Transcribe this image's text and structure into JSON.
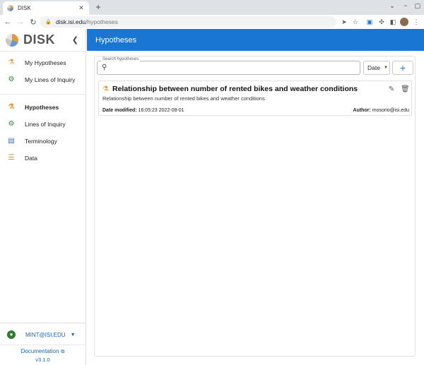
{
  "browser": {
    "tab_title": "DISK",
    "url_host": "disk.isi.edu",
    "url_path": "/hypotheses"
  },
  "sidebar": {
    "brand": "DISK",
    "nav_primary": [
      {
        "label": "My Hypotheses",
        "icon": "flask-icon"
      },
      {
        "label": "My Lines of Inquiry",
        "icon": "gear-icon"
      }
    ],
    "nav_secondary": [
      {
        "label": "Hypotheses",
        "icon": "flask-icon",
        "active": true
      },
      {
        "label": "Lines of Inquiry",
        "icon": "gear-icon"
      },
      {
        "label": "Terminology",
        "icon": "book-icon"
      },
      {
        "label": "Data",
        "icon": "list-icon"
      }
    ],
    "user": "MINT@ISI.EDU",
    "documentation": "Documentation",
    "version": "v3.1.0"
  },
  "appbar": {
    "title": "Hypotheses"
  },
  "search": {
    "label": "Search hypotheses",
    "value": ""
  },
  "sort": {
    "selected": "Date"
  },
  "hypotheses": [
    {
      "title": "Relationship between number of rented bikes and weather conditions",
      "description": "Relationship between number of rented bikes and weather conditions",
      "date_label": "Date modified:",
      "date_value": "16:05:23 2022-08-01",
      "author_label": "Author:",
      "author_value": "mosorio@isi.edu"
    }
  ],
  "colors": {
    "accent": "#1976d2",
    "flask": "#e8912e",
    "gear": "#2e8b3d"
  }
}
